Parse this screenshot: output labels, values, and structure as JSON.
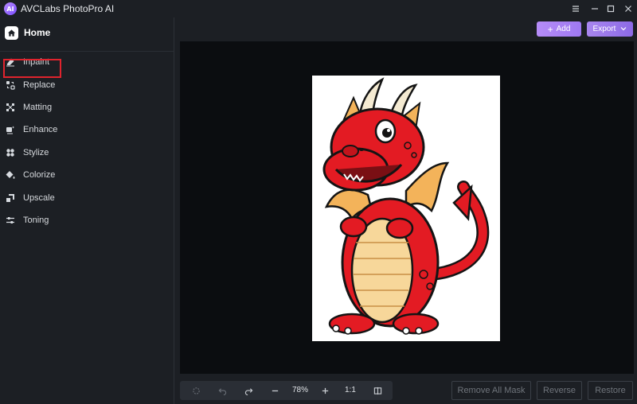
{
  "window": {
    "title": "AVCLabs PhotoPro AI",
    "logo_text": "AI",
    "controls": [
      "menu-icon",
      "minimize-icon",
      "maximize-icon",
      "close-icon"
    ]
  },
  "sidebar": {
    "home_label": "Home",
    "items": [
      {
        "label": "Inpaint",
        "icon": "eraser-icon"
      },
      {
        "label": "Replace",
        "icon": "replace-icon",
        "highlighted": true
      },
      {
        "label": "Matting",
        "icon": "matting-icon"
      },
      {
        "label": "Enhance",
        "icon": "enhance-icon"
      },
      {
        "label": "Stylize",
        "icon": "stylize-icon"
      },
      {
        "label": "Colorize",
        "icon": "colorize-icon"
      },
      {
        "label": "Upscale",
        "icon": "upscale-icon"
      },
      {
        "label": "Toning",
        "icon": "toning-icon"
      }
    ]
  },
  "header": {
    "add_label": "Add",
    "export_label": "Export"
  },
  "toolbar": {
    "zoom": "78%",
    "ratio": "1:1"
  },
  "actions": {
    "remove_all_mask": "Remove All Mask",
    "reverse": "Reverse",
    "restore": "Restore"
  },
  "colors": {
    "accent": "#a684f4",
    "highlight_box": "#e0232d",
    "background": "#1c1f24",
    "canvas": "#0b0d10"
  }
}
